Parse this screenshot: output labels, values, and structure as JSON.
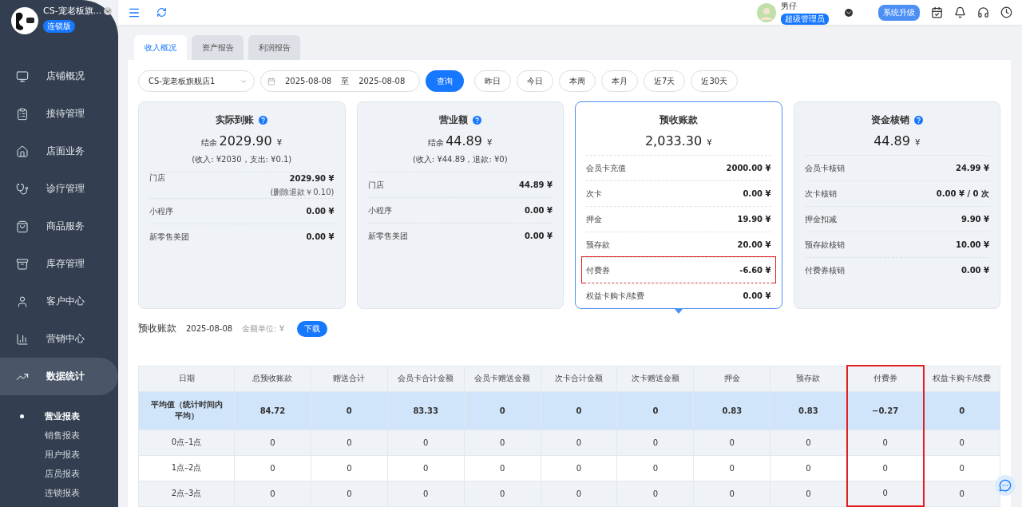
{
  "sidebar": {
    "store_name": "CS-宠老板旗...",
    "edition_badge": "连锁版",
    "nav": [
      {
        "label": "店铺概况",
        "selected": false
      },
      {
        "label": "接待管理",
        "selected": false
      },
      {
        "label": "店面业务",
        "selected": false
      },
      {
        "label": "诊疗管理",
        "selected": false
      },
      {
        "label": "商品服务",
        "selected": false
      },
      {
        "label": "库存管理",
        "selected": false
      },
      {
        "label": "客户中心",
        "selected": false
      },
      {
        "label": "营销中心",
        "selected": false
      },
      {
        "label": "数据统计",
        "selected": true
      }
    ],
    "sub_items": [
      {
        "label": "营业报表",
        "selected": true
      },
      {
        "label": "销售报表",
        "selected": false
      },
      {
        "label": "用户报表",
        "selected": false
      },
      {
        "label": "店员报表",
        "selected": false
      },
      {
        "label": "连锁报表",
        "selected": false
      }
    ]
  },
  "topbar": {
    "user_name": "男仔",
    "role_badge": "超级管理员",
    "upgrade_button": "系统升级"
  },
  "tabs": [
    {
      "label": "收入概况",
      "selected": true
    },
    {
      "label": "资产报告",
      "selected": false
    },
    {
      "label": "利润报告",
      "selected": false
    }
  ],
  "filters": {
    "store": "CS-宠老板旗舰店1",
    "start_date": "2025-08-08",
    "separator": "至",
    "end_date": "2025-08-08",
    "query_button": "查询",
    "quick_ranges": [
      "昨日",
      "今日",
      "本周",
      "本月",
      "近7天",
      "近30天"
    ]
  },
  "cards": [
    {
      "title": "实际到账",
      "help": true,
      "selected": false,
      "prefix": "结余",
      "amount": "2029.90",
      "unit": "¥",
      "note": "(收入: ¥2030，支出: ¥0.1)",
      "rows": [
        {
          "label": "门店",
          "value": "2029.90 ¥",
          "sub": "(删除退款￥0.10)",
          "highlighted": false
        },
        {
          "label": "小程序",
          "value": "0.00 ¥",
          "highlighted": false
        },
        {
          "label": "新零售美团",
          "value": "0.00 ¥",
          "highlighted": false
        }
      ]
    },
    {
      "title": "营业额",
      "help": true,
      "selected": false,
      "prefix": "结余",
      "amount": "44.89",
      "unit": "¥",
      "note": "(收入: ¥44.89，退款: ¥0)",
      "rows": [
        {
          "label": "门店",
          "value": "44.89 ¥",
          "highlighted": false
        },
        {
          "label": "小程序",
          "value": "0.00 ¥",
          "highlighted": false
        },
        {
          "label": "新零售美团",
          "value": "0.00 ¥",
          "highlighted": false
        }
      ]
    },
    {
      "title": "预收账款",
      "help": false,
      "selected": true,
      "amount": "2,033.30",
      "unit": "¥",
      "rows": [
        {
          "label": "会员卡充值",
          "value": "2000.00 ¥",
          "highlighted": false
        },
        {
          "label": "次卡",
          "value": "0.00 ¥",
          "highlighted": false
        },
        {
          "label": "押金",
          "value": "19.90 ¥",
          "highlighted": false
        },
        {
          "label": "预存款",
          "value": "20.00 ¥",
          "highlighted": false
        },
        {
          "label": "付费券",
          "value": "-6.60 ¥",
          "highlighted": true
        },
        {
          "label": "权益卡购卡/续费",
          "value": "0.00 ¥",
          "highlighted": false
        }
      ]
    },
    {
      "title": "资金核销",
      "help": true,
      "selected": false,
      "amount": "44.89",
      "unit": "¥",
      "rows": [
        {
          "label": "会员卡核销",
          "value": "24.99 ¥",
          "highlighted": false
        },
        {
          "label": "次卡核销",
          "value": "0.00 ¥ / 0 次",
          "highlighted": false
        },
        {
          "label": "押金扣减",
          "value": "9.90 ¥",
          "highlighted": false
        },
        {
          "label": "预存款核销",
          "value": "10.00 ¥",
          "highlighted": false
        },
        {
          "label": "付费券核销",
          "value": "0.00 ¥",
          "highlighted": false
        }
      ]
    }
  ],
  "section": {
    "title": "预收账款",
    "date": "2025-08-08",
    "unit_label": "金额单位: ¥",
    "download_button": "下载"
  },
  "table": {
    "columns": [
      {
        "label": "日期",
        "highlighted": false
      },
      {
        "label": "总预收账款",
        "highlighted": false
      },
      {
        "label": "赠送合计",
        "highlighted": false
      },
      {
        "label": "会员卡合计金额",
        "highlighted": false
      },
      {
        "label": "会员卡赠送金额",
        "highlighted": false
      },
      {
        "label": "次卡合计金额",
        "highlighted": false
      },
      {
        "label": "次卡赠送金额",
        "highlighted": false
      },
      {
        "label": "押金",
        "highlighted": false
      },
      {
        "label": "预存款",
        "highlighted": false
      },
      {
        "label": "付费券",
        "highlighted": true
      },
      {
        "label": "权益卡购卡/续费",
        "highlighted": false
      }
    ],
    "rows": [
      {
        "kind": "average",
        "cells": [
          "平均值（统计时间内平均）",
          "84.72",
          "0",
          "83.33",
          "0",
          "0",
          "0",
          "0.83",
          "0.83",
          "−0.27",
          "0"
        ]
      },
      {
        "kind": "normal",
        "cells": [
          "0点–1点",
          "0",
          "0",
          "0",
          "0",
          "0",
          "0",
          "0",
          "0",
          "0",
          "0"
        ]
      },
      {
        "kind": "normal",
        "cells": [
          "1点–2点",
          "0",
          "0",
          "0",
          "0",
          "0",
          "0",
          "0",
          "0",
          "0",
          "0"
        ]
      },
      {
        "kind": "normal",
        "cells": [
          "2点–3点",
          "0",
          "0",
          "0",
          "0",
          "0",
          "0",
          "0",
          "0",
          "0",
          "0"
        ]
      }
    ]
  }
}
